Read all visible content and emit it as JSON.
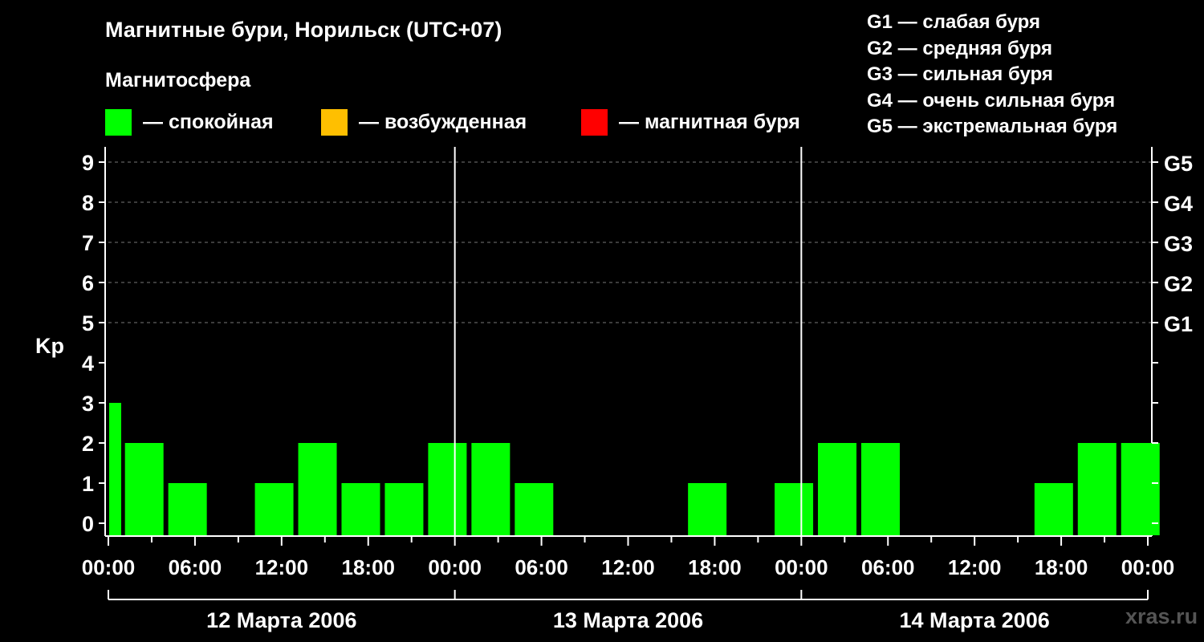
{
  "title": "Магнитные бури, Норильск (UTC+07)",
  "subtitle": "Магнитосфера",
  "legend": [
    {
      "color": "#00ff00",
      "label": "— спокойная"
    },
    {
      "color": "#ffbf00",
      "label": "— возбужденная"
    },
    {
      "color": "#ff0000",
      "label": "— магнитная буря"
    }
  ],
  "g_scale": [
    "G1 — слабая буря",
    "G2 — средняя буря",
    "G3 — сильная буря",
    "G4 — очень сильная буря",
    "G5 — экстремальная буря"
  ],
  "watermark": "xras.ru",
  "chart_data": {
    "type": "bar",
    "ylabel": "Kp",
    "ylim": [
      0,
      9
    ],
    "yticks": [
      "0",
      "1",
      "2",
      "3",
      "4",
      "5",
      "6",
      "7",
      "8",
      "9"
    ],
    "right_axis_labels": [
      {
        "kp": 5,
        "label": "G1"
      },
      {
        "kp": 6,
        "label": "G2"
      },
      {
        "kp": 7,
        "label": "G3"
      },
      {
        "kp": 8,
        "label": "G4"
      },
      {
        "kp": 9,
        "label": "G5"
      }
    ],
    "time_axis_hours": [
      0,
      72
    ],
    "xtick_labels": [
      "00:00",
      "06:00",
      "12:00",
      "18:00",
      "00:00",
      "06:00",
      "12:00",
      "18:00",
      "00:00",
      "06:00",
      "12:00",
      "18:00",
      "00:00"
    ],
    "days": [
      "12 Марта 2006",
      "13 Марта 2006",
      "14 Марта 2006"
    ],
    "grid": "horizontal-dashed",
    "interval_hours": 3,
    "values": [
      3,
      2,
      1,
      0,
      1,
      2,
      1,
      1,
      2,
      2,
      1,
      0,
      0,
      0,
      1,
      0,
      1,
      2,
      2,
      0,
      0,
      0,
      1,
      2,
      2
    ],
    "color": "#00ff00"
  }
}
